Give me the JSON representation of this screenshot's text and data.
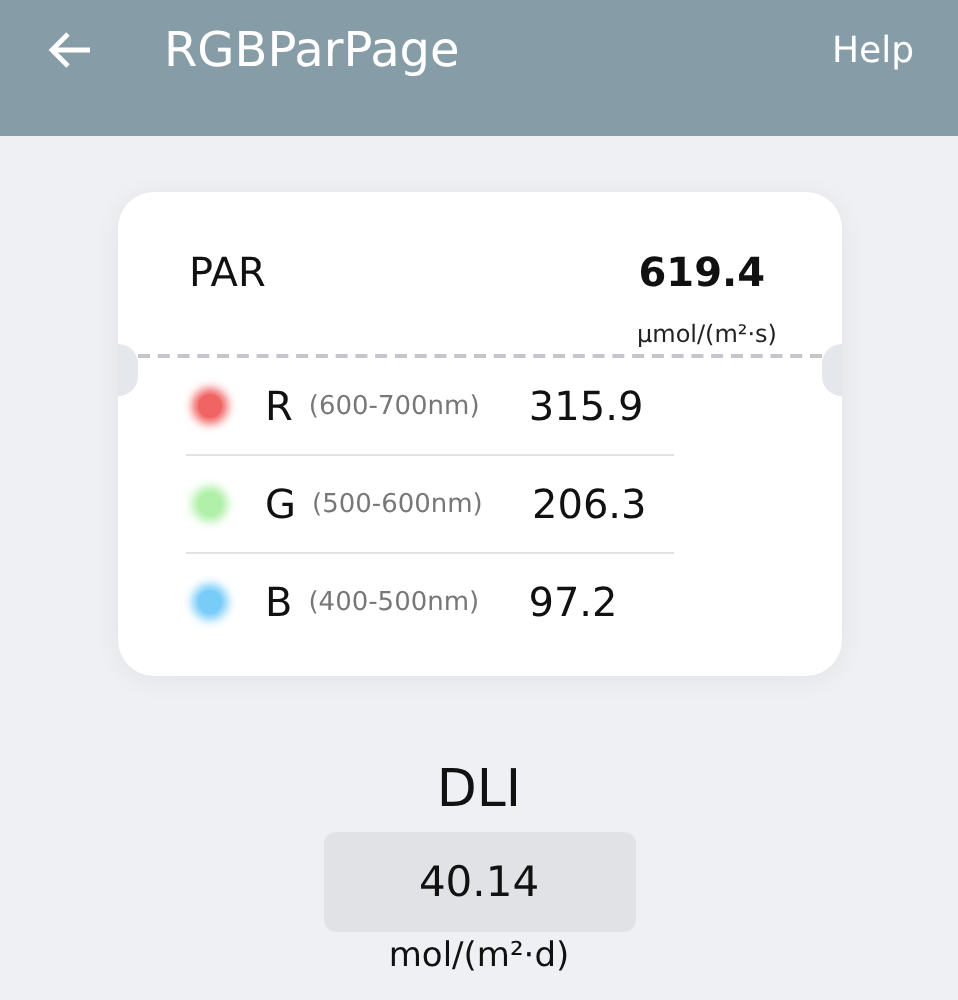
{
  "header": {
    "title": "RGBParPage",
    "action": "Help"
  },
  "par": {
    "label": "PAR",
    "value": "619.4",
    "unit": "μmol/(m²·s)"
  },
  "channels": [
    {
      "name": "R",
      "range": "(600-700nm)",
      "value": "315.9",
      "color": "#f06464"
    },
    {
      "name": "G",
      "range": "(500-600nm)",
      "value": "206.3",
      "color": "#b0f0a8"
    },
    {
      "name": "B",
      "range": "(400-500nm)",
      "value": "97.2",
      "color": "#78ccf8"
    }
  ],
  "dli": {
    "label": "DLI",
    "value": "40.14",
    "unit": "mol/(m²·d)"
  }
}
